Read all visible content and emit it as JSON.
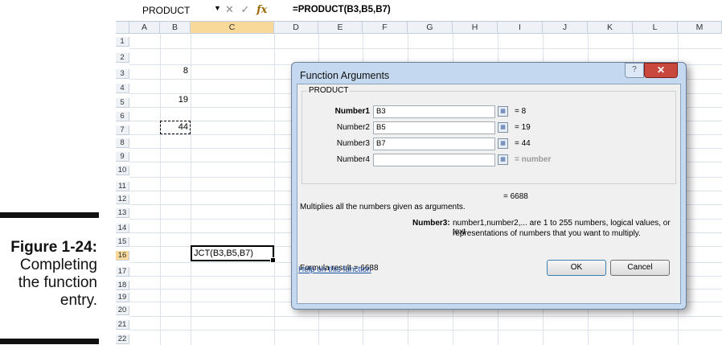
{
  "caption": {
    "figure": "Figure 1-24:",
    "line1": "Completing",
    "line2": "the function",
    "line3": "entry."
  },
  "formula_bar": {
    "name_box": "PRODUCT",
    "formula": "=PRODUCT(B3,B5,B7)",
    "cancel_icon": "✕",
    "enter_icon": "✓",
    "fx_icon": "fx"
  },
  "columns": [
    "A",
    "B",
    "C",
    "D",
    "E",
    "F",
    "G",
    "H",
    "I",
    "J",
    "K",
    "L",
    "M"
  ],
  "rows": [
    "1",
    "2",
    "3",
    "4",
    "5",
    "6",
    "7",
    "8",
    "9",
    "10",
    "11",
    "12",
    "13",
    "14",
    "15",
    "16",
    "17",
    "18",
    "19",
    "20",
    "21",
    "22"
  ],
  "cells": {
    "b3": "8",
    "b5": "19",
    "b7": "44",
    "c16": "JCT(B3,B5,B7)"
  },
  "dialog": {
    "title": "Function Arguments",
    "help_glyph": "?",
    "close_glyph": "✕",
    "function_name": "PRODUCT",
    "args": [
      {
        "label": "Number1",
        "value": "B3",
        "result": "= 8"
      },
      {
        "label": "Number2",
        "value": "B5",
        "result": "= 19"
      },
      {
        "label": "Number3",
        "value": "B7",
        "result": "= 44"
      },
      {
        "label": "Number4",
        "value": "",
        "result": "= number"
      }
    ],
    "collapse_glyph": "▦",
    "total": "= 6688",
    "description": "Multiplies all the numbers given as arguments.",
    "arg_help_label": "Number3:",
    "arg_help_line1": "number1,number2,... are 1 to 255 numbers, logical values, or text",
    "arg_help_line2": "representations of numbers that you want to multiply.",
    "formula_result": "Formula result =  6688",
    "help_link": "Help on this function",
    "ok": "OK",
    "cancel": "Cancel"
  }
}
